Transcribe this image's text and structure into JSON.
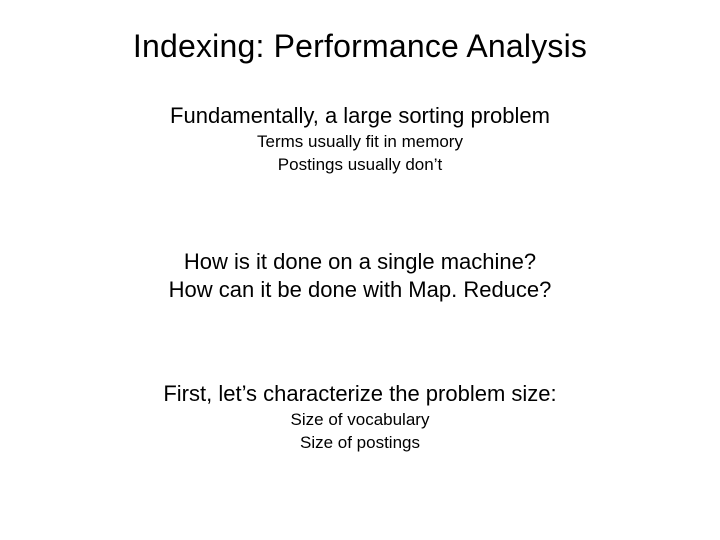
{
  "title": "Indexing: Performance Analysis",
  "section1": {
    "lead": "Fundamentally, a large sorting problem",
    "sub1": "Terms usually fit in memory",
    "sub2": "Postings usually don’t"
  },
  "section2": {
    "q1": "How is it done on a single machine?",
    "q2": "How can it be done with Map. Reduce?"
  },
  "section3": {
    "lead": "First, let’s characterize the problem size:",
    "sub1": "Size of vocabulary",
    "sub2": "Size of postings"
  }
}
